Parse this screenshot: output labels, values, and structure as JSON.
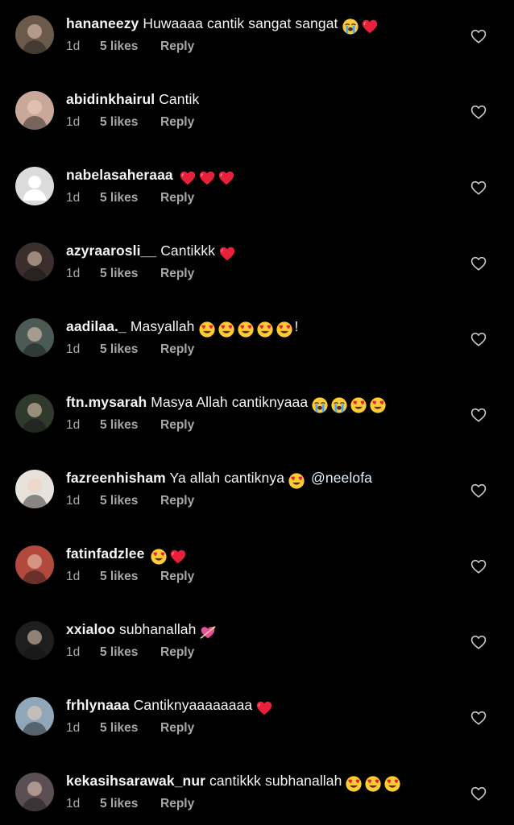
{
  "comments": [
    {
      "username": "hananeezy",
      "text": "Huwaaaa cantik sangat sangat",
      "emojis": [
        "loudly-crying-face",
        "red-heart"
      ],
      "mention": "",
      "time": "1d",
      "likes": "5 likes",
      "reply": "Reply",
      "avatar_color": "#6b5a4a"
    },
    {
      "username": "abidinkhairul",
      "text": "Cantik",
      "emojis": [],
      "mention": "",
      "time": "1d",
      "likes": "5 likes",
      "reply": "Reply",
      "avatar_color": "#c9a89a"
    },
    {
      "username": "nabelasaheraaa",
      "text": "",
      "emojis": [
        "red-heart",
        "red-heart",
        "red-heart"
      ],
      "mention": "",
      "time": "1d",
      "likes": "5 likes",
      "reply": "Reply",
      "avatar_color": "#dbdbdb"
    },
    {
      "username": "azyraarosli__",
      "text": "Cantikkk",
      "emojis": [
        "red-heart"
      ],
      "mention": "",
      "time": "1d",
      "likes": "5 likes",
      "reply": "Reply",
      "avatar_color": "#3a2f2c"
    },
    {
      "username": "aadilaa._",
      "text": "Masyallah",
      "emojis": [
        "heart-eyes",
        "heart-eyes",
        "heart-eyes",
        "heart-eyes",
        "heart-eyes"
      ],
      "trail": "!",
      "mention": "",
      "time": "1d",
      "likes": "5 likes",
      "reply": "Reply",
      "avatar_color": "#4b5a55"
    },
    {
      "username": "ftn.mysarah",
      "text": "Masya Allah cantiknyaaa",
      "emojis": [
        "loudly-crying-face",
        "loudly-crying-face",
        "heart-eyes",
        "heart-eyes"
      ],
      "mention": "",
      "time": "1d",
      "likes": "5 likes",
      "reply": "Reply",
      "avatar_color": "#2f3a2c"
    },
    {
      "username": "fazreenhisham",
      "text": "Ya allah cantiknya",
      "emojis": [
        "heart-eyes"
      ],
      "mention": "@neelofa",
      "time": "1d",
      "likes": "5 likes",
      "reply": "Reply",
      "avatar_color": "#e8e2dc"
    },
    {
      "username": "fatinfadzlee",
      "text": "",
      "emojis": [
        "heart-eyes",
        "red-heart"
      ],
      "mention": "",
      "time": "1d",
      "likes": "5 likes",
      "reply": "Reply",
      "avatar_color": "#b14a3c"
    },
    {
      "username": "xxialoo",
      "text": "subhanallah",
      "emojis": [
        "heart-with-arrow"
      ],
      "mention": "",
      "time": "1d",
      "likes": "5 likes",
      "reply": "Reply",
      "avatar_color": "#1e1e1e"
    },
    {
      "username": "frhlynaaa",
      "text": "Cantiknyaaaaaaaa",
      "emojis": [
        "red-heart"
      ],
      "mention": "",
      "time": "1d",
      "likes": "5 likes",
      "reply": "Reply",
      "avatar_color": "#8fa7b8"
    },
    {
      "username": "kekasihsarawak_nur",
      "text": "cantikkk subhanallah",
      "emojis": [
        "heart-eyes",
        "heart-eyes",
        "heart-eyes"
      ],
      "mention": "",
      "time": "1d",
      "likes": "5 likes",
      "reply": "Reply",
      "avatar_color": "#5a4f52"
    }
  ],
  "icons": {
    "like": "heart-outline-icon"
  },
  "colors": {
    "background": "#000000",
    "text": "#f5f5f5",
    "meta": "#a8a8a8",
    "mention": "#e0f1ff",
    "heart_emoji": "#e8203a",
    "emoji_face": "#ffcc33"
  }
}
